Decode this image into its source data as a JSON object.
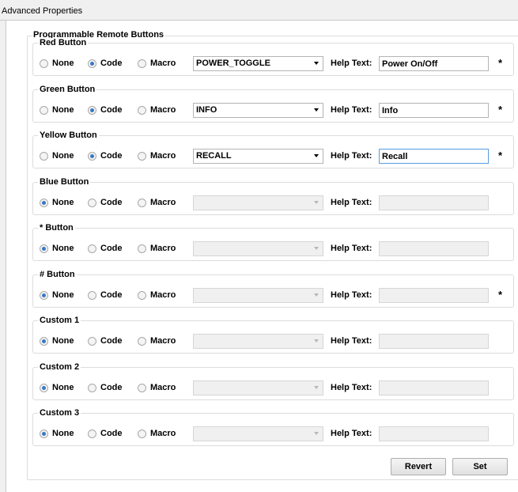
{
  "window": {
    "title": "Advanced Properties"
  },
  "panel": {
    "group_title": "Programmable Remote Buttons"
  },
  "options": {
    "none": "None",
    "code": "Code",
    "macro": "Macro"
  },
  "help_label": "Help Text:",
  "asterisk": "*",
  "buttons": [
    {
      "title": "Red Button",
      "mode": "code",
      "command": "POWER_TOGGLE",
      "help_text": "Power On/Off",
      "asterisk": true
    },
    {
      "title": "Green Button",
      "mode": "code",
      "command": "INFO",
      "help_text": "Info",
      "asterisk": true
    },
    {
      "title": "Yellow Button",
      "mode": "code",
      "command": "RECALL",
      "help_text": "Recall",
      "asterisk": true
    },
    {
      "title": "Blue Button",
      "mode": "none",
      "command": "",
      "help_text": "",
      "asterisk": false
    },
    {
      "title": "* Button",
      "mode": "none",
      "command": "",
      "help_text": "",
      "asterisk": false
    },
    {
      "title": "# Button",
      "mode": "none",
      "command": "",
      "help_text": "",
      "asterisk": true
    },
    {
      "title": "Custom 1",
      "mode": "none",
      "command": "",
      "help_text": "",
      "asterisk": false
    },
    {
      "title": "Custom 2",
      "mode": "none",
      "command": "",
      "help_text": "",
      "asterisk": false
    },
    {
      "title": "Custom 3",
      "mode": "none",
      "command": "",
      "help_text": "",
      "asterisk": false
    }
  ],
  "actions": {
    "revert": "Revert",
    "set": "Set"
  },
  "colors": {
    "radio_checked": "#3a78c6",
    "focus_border": "#569de5"
  }
}
